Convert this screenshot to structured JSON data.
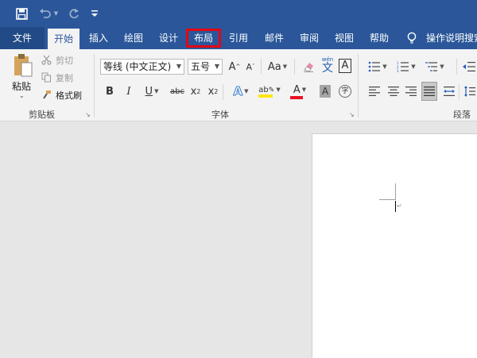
{
  "qat": {
    "save_icon": "save-icon",
    "undo_icon": "undo-icon",
    "redo_icon": "redo-icon",
    "customize_icon": "customize-qat-icon"
  },
  "tabs": {
    "file": "文件",
    "home": "开始",
    "insert": "插入",
    "draw": "绘图",
    "design": "设计",
    "layout": "布局",
    "references": "引用",
    "mailings": "邮件",
    "review": "审阅",
    "view": "视图",
    "help": "帮助",
    "tell_me": "操作说明搜索"
  },
  "clipboard": {
    "paste": "粘贴",
    "cut": "剪切",
    "copy": "复制",
    "format_painter": "格式刷",
    "group_label": "剪贴板"
  },
  "font": {
    "font_name": "等线 (中文正文)",
    "font_size": "五号",
    "grow": "A",
    "shrink": "A",
    "change_case": "Aa",
    "phonetic": "文",
    "bold": "B",
    "italic": "I",
    "underline": "U",
    "strikethrough": "abc",
    "subscript": "x",
    "superscript": "x",
    "group_label": "字体"
  },
  "paragraph": {
    "group_label": "段落"
  },
  "colors": {
    "title_blue": "#2b579a",
    "highlight_red": "#e30613",
    "highlight_yellow": "#ffe600",
    "font_red": "#e81123"
  }
}
